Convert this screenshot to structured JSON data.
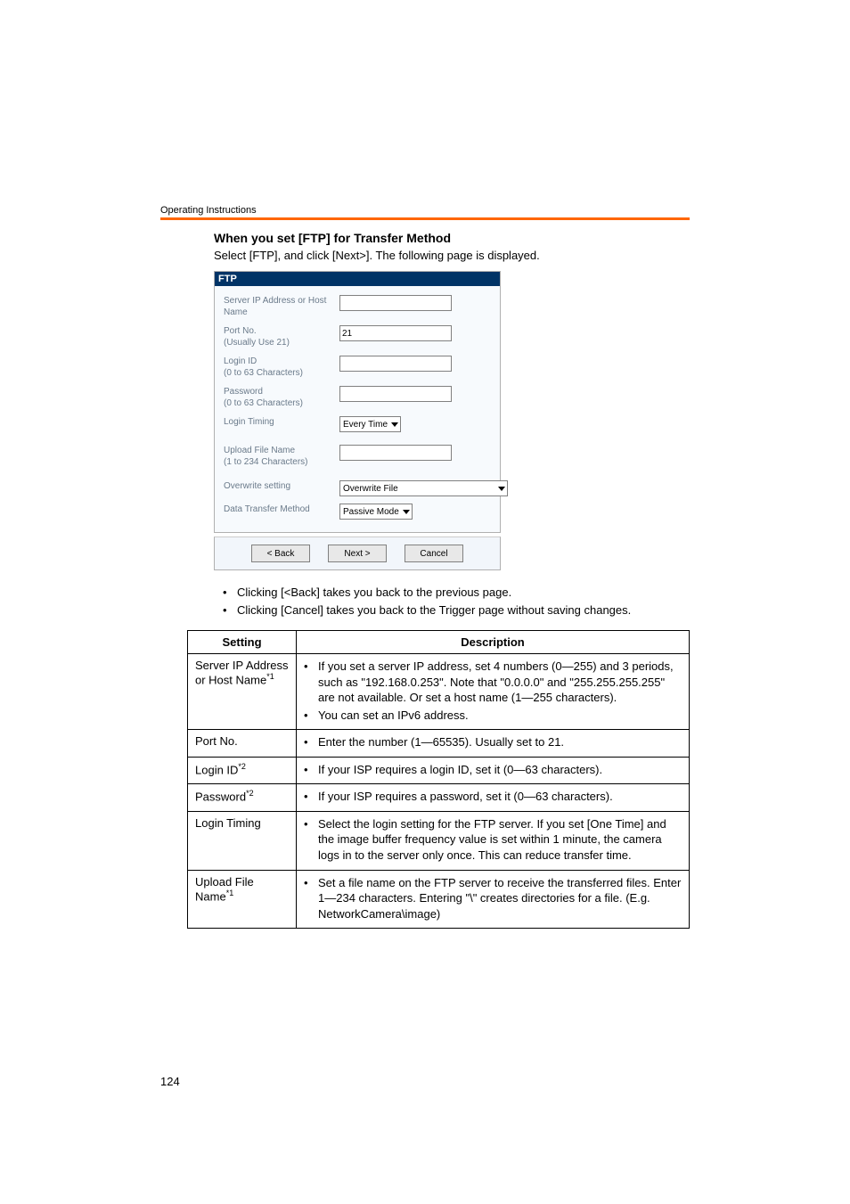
{
  "running_head": "Operating Instructions",
  "heading": "When you set [FTP] for Transfer Method",
  "intro_line": "Select [FTP], and click [Next>]. The following page is displayed.",
  "screenshot": {
    "title": "FTP",
    "rows": {
      "server_label": "Server IP Address or Host Name",
      "port_label": "Port No.\n(Usually Use 21)",
      "port_value": "21",
      "login_label": "Login ID\n(0 to 63 Characters)",
      "password_label": "Password\n(0 to 63 Characters)",
      "timing_label": "Login Timing",
      "timing_value": "Every Time",
      "upload_label": "Upload File Name\n(1 to 234 Characters)",
      "overwrite_label": "Overwrite setting",
      "overwrite_value": "Overwrite File",
      "method_label": "Data Transfer Method",
      "method_value": "Passive Mode"
    },
    "buttons": {
      "back": "< Back",
      "next": "Next >",
      "cancel": "Cancel"
    }
  },
  "notes": {
    "n1": "Clicking [<Back] takes you back to the previous page.",
    "n2": "Clicking [Cancel] takes you back to the Trigger page without saving changes."
  },
  "table": {
    "headers": {
      "setting": "Setting",
      "description": "Description"
    },
    "rows": {
      "r1": {
        "setting": "Server IP Address or Host Name",
        "ref": "*1",
        "b1": "If you set a server IP address, set 4 numbers (0—255) and 3 periods, such as \"192.168.0.253\". Note that \"0.0.0.0\" and \"255.255.255.255\" are not available. Or set a host name (1—255 characters).",
        "b2": "You can set an IPv6 address."
      },
      "r2": {
        "setting": "Port No.",
        "b1": "Enter the number (1—65535). Usually set to 21."
      },
      "r3": {
        "setting": "Login ID",
        "ref": "*2",
        "b1": "If your ISP requires a login ID, set it (0—63 characters)."
      },
      "r4": {
        "setting": "Password",
        "ref": "*2",
        "b1": "If your ISP requires a password, set it (0—63 characters)."
      },
      "r5": {
        "setting": "Login Timing",
        "b1": "Select the login setting for the FTP server. If you set [One Time] and the image buffer frequency value is set within 1 minute, the camera logs in to the server only once. This can reduce transfer time."
      },
      "r6": {
        "setting": "Upload File Name",
        "ref": "*1",
        "b1": "Set a file name on the FTP server to receive the transferred files. Enter 1—234 characters. Entering \"\\\" creates directories for a file. (E.g. NetworkCamera\\image)"
      }
    }
  },
  "page_number": "124"
}
